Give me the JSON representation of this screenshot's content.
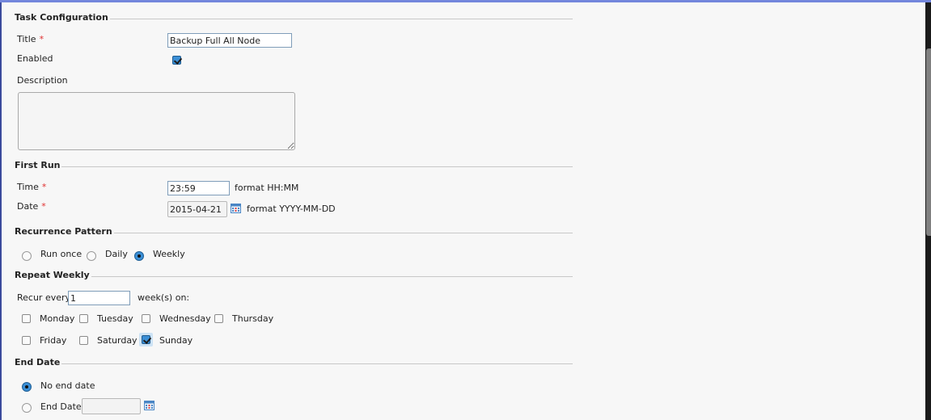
{
  "task_configuration": {
    "heading": "Task Configuration",
    "title_label": "Title",
    "title_required": "*",
    "title_value": "Backup Full All Node",
    "enabled_label": "Enabled",
    "enabled_checked": true,
    "description_label": "Description",
    "description_value": ""
  },
  "first_run": {
    "heading": "First Run",
    "time_label": "Time",
    "time_required": "*",
    "time_value": "23:59",
    "time_format_hint": "format HH:MM",
    "date_label": "Date",
    "date_required": "*",
    "date_value": "2015-04-21",
    "date_format_hint": "format YYYY-MM-DD",
    "calendar_icon": "calendar-icon"
  },
  "recurrence_pattern": {
    "heading": "Recurrence Pattern",
    "options": [
      {
        "label": "Run once",
        "selected": false
      },
      {
        "label": "Daily",
        "selected": false
      },
      {
        "label": "Weekly",
        "selected": true
      }
    ]
  },
  "repeat_weekly": {
    "heading": "Repeat Weekly",
    "recur_every_label": "Recur every",
    "recur_every_value": "1",
    "weeks_on_label": "week(s) on:",
    "days": [
      {
        "label": "Monday",
        "checked": false
      },
      {
        "label": "Tuesday",
        "checked": false
      },
      {
        "label": "Wednesday",
        "checked": false
      },
      {
        "label": "Thursday",
        "checked": false
      },
      {
        "label": "Friday",
        "checked": false
      },
      {
        "label": "Saturday",
        "checked": false
      },
      {
        "label": "Sunday",
        "checked": true
      }
    ]
  },
  "end_date": {
    "heading": "End Date",
    "options": [
      {
        "label": "No end date",
        "selected": true
      },
      {
        "label": "End Date",
        "selected": false
      }
    ],
    "end_date_value": "",
    "calendar_icon": "calendar-icon"
  },
  "colors": {
    "top_bar": "#7386dc",
    "accent": "#3b8fd6",
    "required": "#e03030"
  }
}
